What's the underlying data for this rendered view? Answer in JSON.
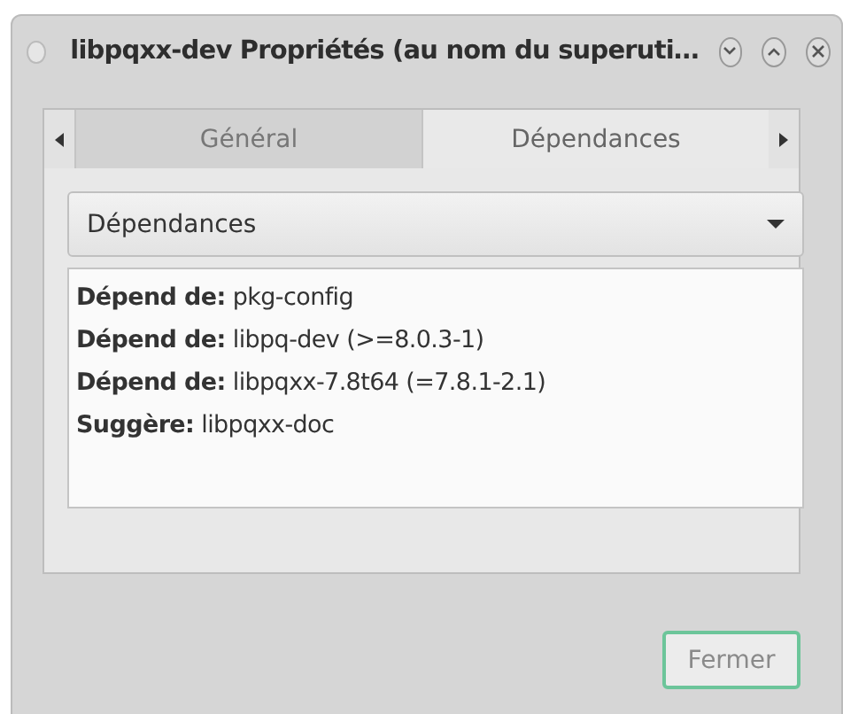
{
  "window": {
    "title": "libpqxx-dev Propriétés (au nom du superuti…"
  },
  "tabs": [
    {
      "label": "Général",
      "selected": false
    },
    {
      "label": "Dépendances",
      "selected": true
    }
  ],
  "dropdown": {
    "value": "Dépendances"
  },
  "dependencies": [
    "**Dépend de:** pkg-config",
    "**Dépend de:** libpq-dev (>=8.0.3-1)",
    "**Dépend de:** libpqxx-7.8t64 (=7.8.1-2.1)",
    "**Suggère:** libpqxx-doc"
  ],
  "buttons": [
    {
      "label": "Fermer"
    }
  ]
}
